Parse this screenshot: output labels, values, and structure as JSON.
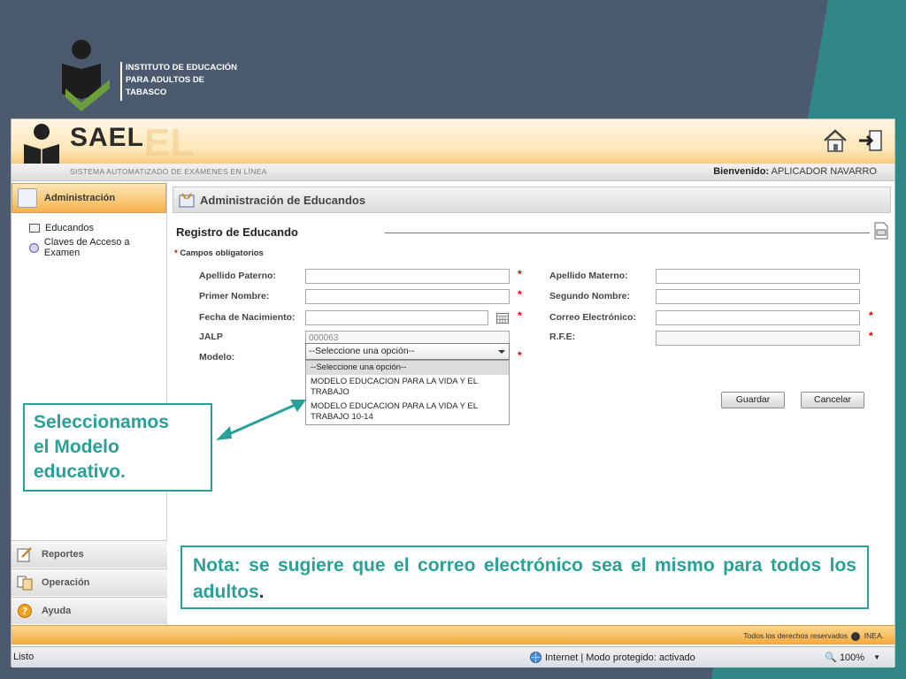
{
  "slide": {
    "institute_lines": [
      "INSTITUTO DE EDUCACIÓN",
      "PARA ADULTOS DE",
      "TABASCO"
    ],
    "callout_model": [
      "Seleccionamos",
      "el Modelo",
      "educativo."
    ],
    "callout_note_main": "Nota: se sugiere que el correo electrónico sea el mismo para todos los adultos",
    "callout_note_tail": "."
  },
  "header": {
    "app_name": "SAEL",
    "app_name_ghost": "EL",
    "subtitle": "SISTEMA AUTOMATIZADO DE EXÁMENES EN LÍNEA",
    "welcome_label": "Bienvenido:",
    "welcome_user": "APLICADOR NAVARRO"
  },
  "sidebar": {
    "section": "Administración",
    "items": [
      {
        "label": "Educandos"
      },
      {
        "label": "Claves de Acceso a Examen"
      }
    ],
    "bottom": [
      {
        "label": "Reportes"
      },
      {
        "label": "Operación"
      },
      {
        "label": "Ayuda"
      }
    ]
  },
  "main": {
    "panel_title": "Administración de Educandos",
    "section_title": "Registro de Educando",
    "required_note": "Campos obligatorios",
    "fields": {
      "apellido_paterno": {
        "label": "Apellido Paterno:",
        "value": ""
      },
      "apellido_materno": {
        "label": "Apellido Materno:",
        "value": ""
      },
      "primer_nombre": {
        "label": "Primer Nombre:",
        "value": ""
      },
      "segundo_nombre": {
        "label": "Segundo Nombre:",
        "value": ""
      },
      "fecha_nacimiento": {
        "label": "Fecha de Nacimiento:",
        "value": ""
      },
      "correo": {
        "label": "Correo Electrónico:",
        "value": ""
      },
      "jalp": {
        "label": "JALP",
        "value": "000063"
      },
      "rfe": {
        "label": "R.F.E:",
        "value": ""
      },
      "modelo": {
        "label": "Modelo:",
        "value": "--Seleccione una opción--"
      }
    },
    "modelo_options": [
      "--Seleccione una opción--",
      "MODELO EDUCACION PARA LA VIDA Y EL TRABAJO",
      "MODELO EDUCACION PARA LA VIDA Y EL TRABAJO 10-14"
    ],
    "buttons": {
      "save": "Guardar",
      "cancel": "Cancelar"
    }
  },
  "footer": {
    "rights": "Todos los derechos reservados",
    "brand": "INEA."
  },
  "statusbar": {
    "left": "Listo",
    "zone": "Internet | Modo protegido: activado",
    "zoom": "100%"
  },
  "colors": {
    "accent_orange": "#f6b24c",
    "callout_teal": "#2aa198",
    "required_red": "#dd0000"
  }
}
